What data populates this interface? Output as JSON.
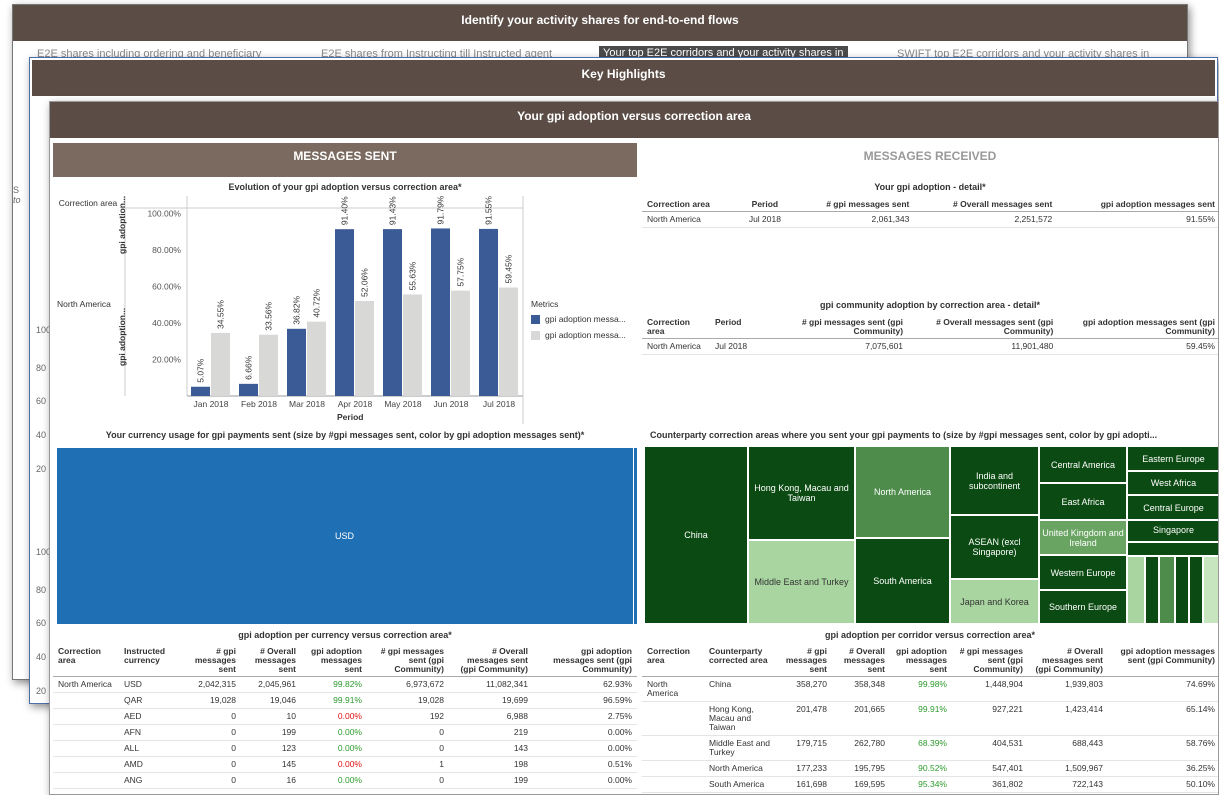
{
  "panel1": {
    "title": "Identify your activity shares for end-to-end flows",
    "tabs": [
      "E2E shares including ordering and beneficiary",
      "E2E shares from Instructing till Instructed agent",
      "Your top E2E corridors and your activity shares in",
      "SWIFT top E2E corridors and your activity shares in"
    ],
    "side_labels": [
      "S",
      "to"
    ]
  },
  "panel2": {
    "title": "Key Highlights",
    "side_ticks": [
      "100",
      "80",
      "60",
      "40",
      "20",
      "100",
      "80",
      "60",
      "40",
      "20"
    ]
  },
  "panel3": {
    "title": "Your gpi adoption versus correction area",
    "sent_header": "MESSAGES SENT",
    "received_header": "MESSAGES RECEIVED"
  },
  "evolution": {
    "title": "Evolution of your gpi adoption versus correction area*",
    "row_header": "Correction area",
    "row_label": "North America",
    "yaxis_label_top": "gpi adoption...",
    "yaxis_label_bottom": "gpi adoption...",
    "xaxis_label": "Period",
    "legend_title": "Metrics",
    "legend": [
      {
        "label": "gpi adoption messa...",
        "color": "#3a5b95"
      },
      {
        "label": "gpi adoption messa...",
        "color": "#d8d8d6"
      }
    ]
  },
  "chart_data": {
    "type": "bar",
    "categories": [
      "Jan 2018",
      "Feb 2018",
      "Mar 2018",
      "Apr 2018",
      "May 2018",
      "Jun 2018",
      "Jul 2018"
    ],
    "series": [
      {
        "name": "gpi adoption messa...",
        "values": [
          5.07,
          6.66,
          36.82,
          91.4,
          91.43,
          91.79,
          91.55
        ],
        "labels": [
          "5.07%",
          "6.66%",
          "36.82%",
          "91.40%",
          "91.43%",
          "91.79%",
          "91.55%"
        ],
        "color": "#3a5b95"
      },
      {
        "name": "gpi adoption messa...",
        "values": [
          34.55,
          33.56,
          40.72,
          52.06,
          55.63,
          57.75,
          59.45
        ],
        "labels": [
          "34.55%",
          "33.56%",
          "40.72%",
          "52.06%",
          "55.63%",
          "57.75%",
          "59.45%"
        ],
        "color": "#d8d8d6"
      }
    ],
    "yticks": [
      "100.00%",
      "80.00%",
      "60.00%",
      "40.00%",
      "20.00%"
    ],
    "ylim": [
      0,
      100
    ],
    "xlabel": "Period",
    "legend_title": "Metrics",
    "legend_position": "right",
    "grid": false
  },
  "detail": {
    "title": "Your gpi adoption - detail*",
    "headers": [
      "Correction area",
      "Period",
      "# gpi messages sent",
      "# Overall messages sent",
      "gpi adoption messages sent"
    ],
    "row": [
      "North America",
      "Jul 2018",
      "2,061,343",
      "2,251,572",
      "91.55%"
    ]
  },
  "community": {
    "title": "gpi community adoption by correction area - detail*",
    "headers": [
      "Correction area",
      "Period",
      "# gpi messages sent (gpi Community)",
      "# Overall messages sent (gpi Community)",
      "gpi adoption messages sent (gpi Community)"
    ],
    "row": [
      "North America",
      "Jul 2018",
      "7,075,601",
      "11,901,480",
      "59.45%"
    ]
  },
  "currency_usage": {
    "title": "Your currency usage for gpi payments sent (size by #gpi messages sent, color by gpi adoption messages sent)*",
    "main_label": "USD",
    "color": "#1f6fb4"
  },
  "counterparty": {
    "title": "Counterparty correction areas where you sent your gpi payments to (size by #gpi messages sent, color by gpi adopti...",
    "cells": [
      "China",
      "Hong Kong, Macau and Taiwan",
      "Middle East and Turkey",
      "North America",
      "South America",
      "India and subcontinent",
      "ASEAN (excl Singapore)",
      "Japan and Korea",
      "Central America",
      "East Africa",
      "United Kingdom and Ireland",
      "Western Europe",
      "Southern Europe",
      "Eastern Europe",
      "West Africa",
      "Central Europe",
      "Singapore"
    ]
  },
  "per_currency": {
    "title": "gpi adoption per currency versus correction area*",
    "headers": [
      "Correction area",
      "Instructed currency",
      "# gpi messages sent",
      "# Overall messages sent",
      "gpi adoption messages sent",
      "# gpi messages sent (gpi Community)",
      "# Overall messages sent (gpi Community)",
      "gpi adoption messages sent (gpi Community)"
    ],
    "area": "North America",
    "rows": [
      {
        "cur": "USD",
        "gpi": "2,042,315",
        "overall": "2,045,961",
        "adopt": "99.82%",
        "adopt_color": "green",
        "gpi_c": "6,973,672",
        "overall_c": "11,082,341",
        "adopt_c": "62.93%"
      },
      {
        "cur": "QAR",
        "gpi": "19,028",
        "overall": "19,046",
        "adopt": "99.91%",
        "adopt_color": "green",
        "gpi_c": "19,028",
        "overall_c": "19,699",
        "adopt_c": "96.59%"
      },
      {
        "cur": "AED",
        "gpi": "0",
        "overall": "10",
        "adopt": "0.00%",
        "adopt_color": "red",
        "gpi_c": "192",
        "overall_c": "6,988",
        "adopt_c": "2.75%"
      },
      {
        "cur": "AFN",
        "gpi": "0",
        "overall": "199",
        "adopt": "0.00%",
        "adopt_color": "green",
        "gpi_c": "0",
        "overall_c": "219",
        "adopt_c": "0.00%"
      },
      {
        "cur": "ALL",
        "gpi": "0",
        "overall": "123",
        "adopt": "0.00%",
        "adopt_color": "green",
        "gpi_c": "0",
        "overall_c": "143",
        "adopt_c": "0.00%"
      },
      {
        "cur": "AMD",
        "gpi": "0",
        "overall": "145",
        "adopt": "0.00%",
        "adopt_color": "red",
        "gpi_c": "1",
        "overall_c": "198",
        "adopt_c": "0.51%"
      },
      {
        "cur": "ANG",
        "gpi": "0",
        "overall": "16",
        "adopt": "0.00%",
        "adopt_color": "green",
        "gpi_c": "0",
        "overall_c": "199",
        "adopt_c": "0.00%"
      }
    ]
  },
  "per_corridor": {
    "title": "gpi adoption per corridor versus correction area*",
    "headers": [
      "Correction area",
      "Counterparty corrected area",
      "# gpi messages sent",
      "# Overall messages sent",
      "gpi adoption messages sent",
      "# gpi messages sent (gpi Community)",
      "# Overall messages sent (gpi Community)",
      "gpi adoption messages sent (gpi Community)"
    ],
    "area": "North America",
    "rows": [
      {
        "cp": "China",
        "gpi": "358,270",
        "overall": "358,348",
        "adopt": "99.98%",
        "adopt_color": "green",
        "gpi_c": "1,448,904",
        "overall_c": "1,939,803",
        "adopt_c": "74.69%"
      },
      {
        "cp": "Hong Kong, Macau and Taiwan",
        "gpi": "201,478",
        "overall": "201,665",
        "adopt": "99.91%",
        "adopt_color": "green",
        "gpi_c": "927,221",
        "overall_c": "1,423,414",
        "adopt_c": "65.14%"
      },
      {
        "cp": "Middle East and Turkey",
        "gpi": "179,715",
        "overall": "262,780",
        "adopt": "68.39%",
        "adopt_color": "green",
        "gpi_c": "404,531",
        "overall_c": "688,443",
        "adopt_c": "58.76%"
      },
      {
        "cp": "North America",
        "gpi": "177,233",
        "overall": "195,795",
        "adopt": "90.52%",
        "adopt_color": "green",
        "gpi_c": "547,401",
        "overall_c": "1,509,967",
        "adopt_c": "36.25%"
      },
      {
        "cp": "South America",
        "gpi": "161,698",
        "overall": "169,595",
        "adopt": "95.34%",
        "adopt_color": "green",
        "gpi_c": "361,802",
        "overall_c": "722,143",
        "adopt_c": "50.10%"
      }
    ]
  }
}
